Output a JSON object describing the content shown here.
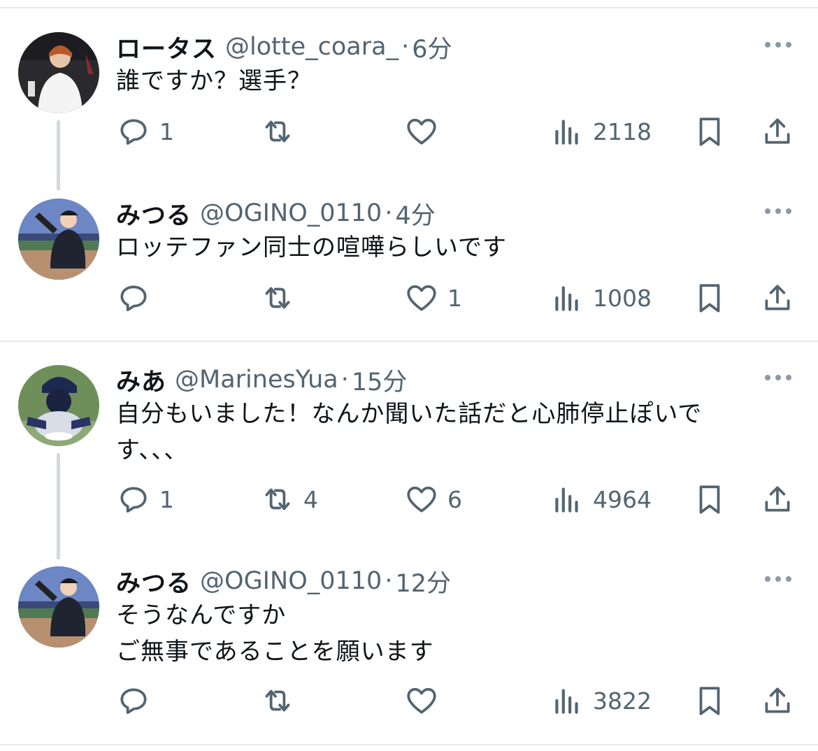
{
  "tweets": [
    {
      "name": "ロータス",
      "handle": "@lotte_coara_",
      "sep": "·",
      "time": "6分",
      "text": [
        "誰ですか？選手？"
      ],
      "reply_count": "1",
      "retweet_count": "",
      "like_count": "",
      "view_count": "2118"
    },
    {
      "name": "みつる",
      "handle": "@OGINO_0110",
      "sep": "·",
      "time": "4分",
      "text": [
        "ロッテファン同士の喧嘩らしいです"
      ],
      "reply_count": "",
      "retweet_count": "",
      "like_count": "1",
      "view_count": "1008"
    },
    {
      "name": "みあ",
      "handle": "@MarinesYua",
      "sep": "·",
      "time": "15分",
      "text": [
        "自分もいました！なんか聞いた話だと心肺停止ぽいで",
        "す、、、"
      ],
      "reply_count": "1",
      "retweet_count": "4",
      "like_count": "6",
      "view_count": "4964"
    },
    {
      "name": "みつる",
      "handle": "@OGINO_0110",
      "sep": "·",
      "time": "12分",
      "text": [
        "そうなんですか",
        "ご無事であることを願います"
      ],
      "reply_count": "",
      "retweet_count": "",
      "like_count": "",
      "view_count": "3822"
    }
  ],
  "icons": {
    "more": "more-dots-icon",
    "reply": "reply-bubble-icon",
    "retweet": "retweet-icon",
    "like": "heart-icon",
    "views": "bar-chart-icon",
    "bookmark": "bookmark-icon",
    "share": "share-upload-icon"
  },
  "colors": {
    "text": "#0f1419",
    "secondary": "#536471",
    "divider": "#e6e9ec",
    "thread_line": "#cfd9de"
  }
}
